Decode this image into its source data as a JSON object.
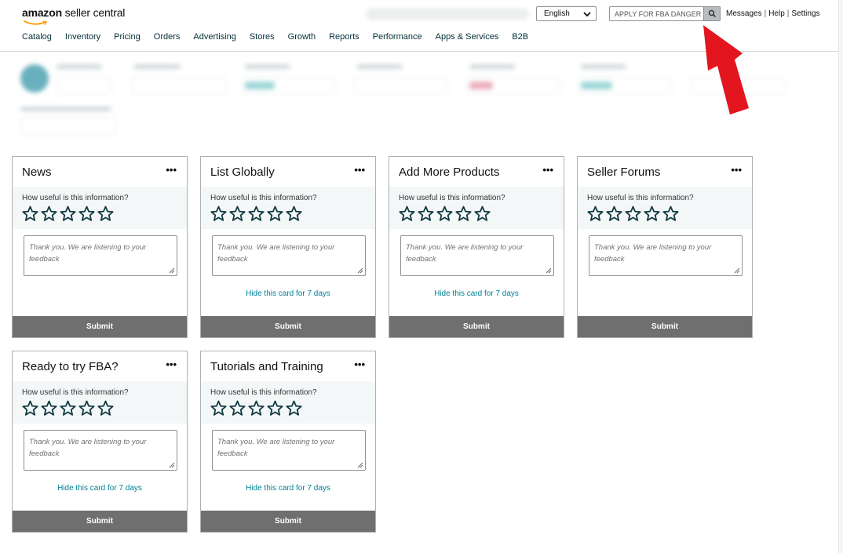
{
  "header": {
    "logo_amazon": "amazon",
    "logo_rest": " seller central",
    "language": "English",
    "search_value": "APPLY FOR FBA DANGER",
    "links": [
      "Messages",
      "Help",
      "Settings"
    ],
    "separator": "|"
  },
  "nav": {
    "items": [
      "Catalog",
      "Inventory",
      "Pricing",
      "Orders",
      "Advertising",
      "Stores",
      "Growth",
      "Reports",
      "Performance",
      "Apps & Services",
      "B2B"
    ]
  },
  "common": {
    "more": "•••",
    "question": "How useful is this information?",
    "placeholder": "Thank you. We are listening to your feedback",
    "hide": "Hide this card for 7 days",
    "submit": "Submit"
  },
  "cards": [
    {
      "title": "News",
      "hide_visible": false
    },
    {
      "title": "List Globally",
      "hide_visible": true
    },
    {
      "title": "Add More Products",
      "hide_visible": true
    },
    {
      "title": "Seller Forums",
      "hide_visible": false
    },
    {
      "title": "Ready to try FBA?",
      "hide_visible": true
    },
    {
      "title": "Tutorials and Training",
      "hide_visible": true
    }
  ],
  "colors": {
    "arrow": "#e3161f",
    "link": "#008296",
    "submit_bg": "#6f6f6f",
    "star_stroke": "#0f3a40"
  }
}
